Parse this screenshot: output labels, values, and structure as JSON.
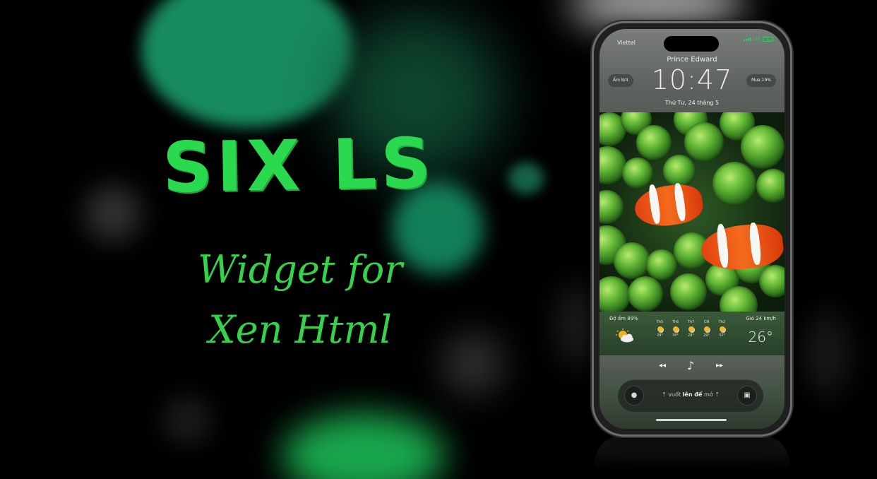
{
  "headline": {
    "title": "SIX LS",
    "subtitle_line1": "Widget for",
    "subtitle_line2": "Xen Html"
  },
  "colors": {
    "accent": "#2bd94f",
    "subtitle": "#35d24a",
    "status_green": "#2cd060"
  },
  "status_bar": {
    "carrier": "Viettel",
    "network": "LTE",
    "battery_label": "6"
  },
  "lockscreen": {
    "location": "Prince Edward",
    "time": "10:47",
    "date": "Thứ Tư, 24 tháng 5",
    "left_pill": "Ấm 8/4",
    "right_pill": "Mưa 19%"
  },
  "weather": {
    "humidity": "Độ ẩm 89%",
    "wind": "Gió 24 km/h",
    "temperature": "26°",
    "current_icon": "sun-cloud-icon",
    "forecast": [
      {
        "day": "Th5",
        "temp": "29°"
      },
      {
        "day": "Th6",
        "temp": "30°"
      },
      {
        "day": "Th7",
        "temp": "29°"
      },
      {
        "day": "CN",
        "temp": "29°"
      },
      {
        "day": "Th2",
        "temp": "32°"
      }
    ]
  },
  "music": {
    "prev_icon": "rewind-icon",
    "note_icon": "music-note-icon",
    "next_icon": "fast-forward-icon"
  },
  "unlock": {
    "text_prefix": "⇡ vuốt ",
    "text_bold": "lên để",
    "text_suffix": " mở ⇡",
    "left_icon": "flashlight-icon",
    "right_icon": "camera-icon"
  }
}
